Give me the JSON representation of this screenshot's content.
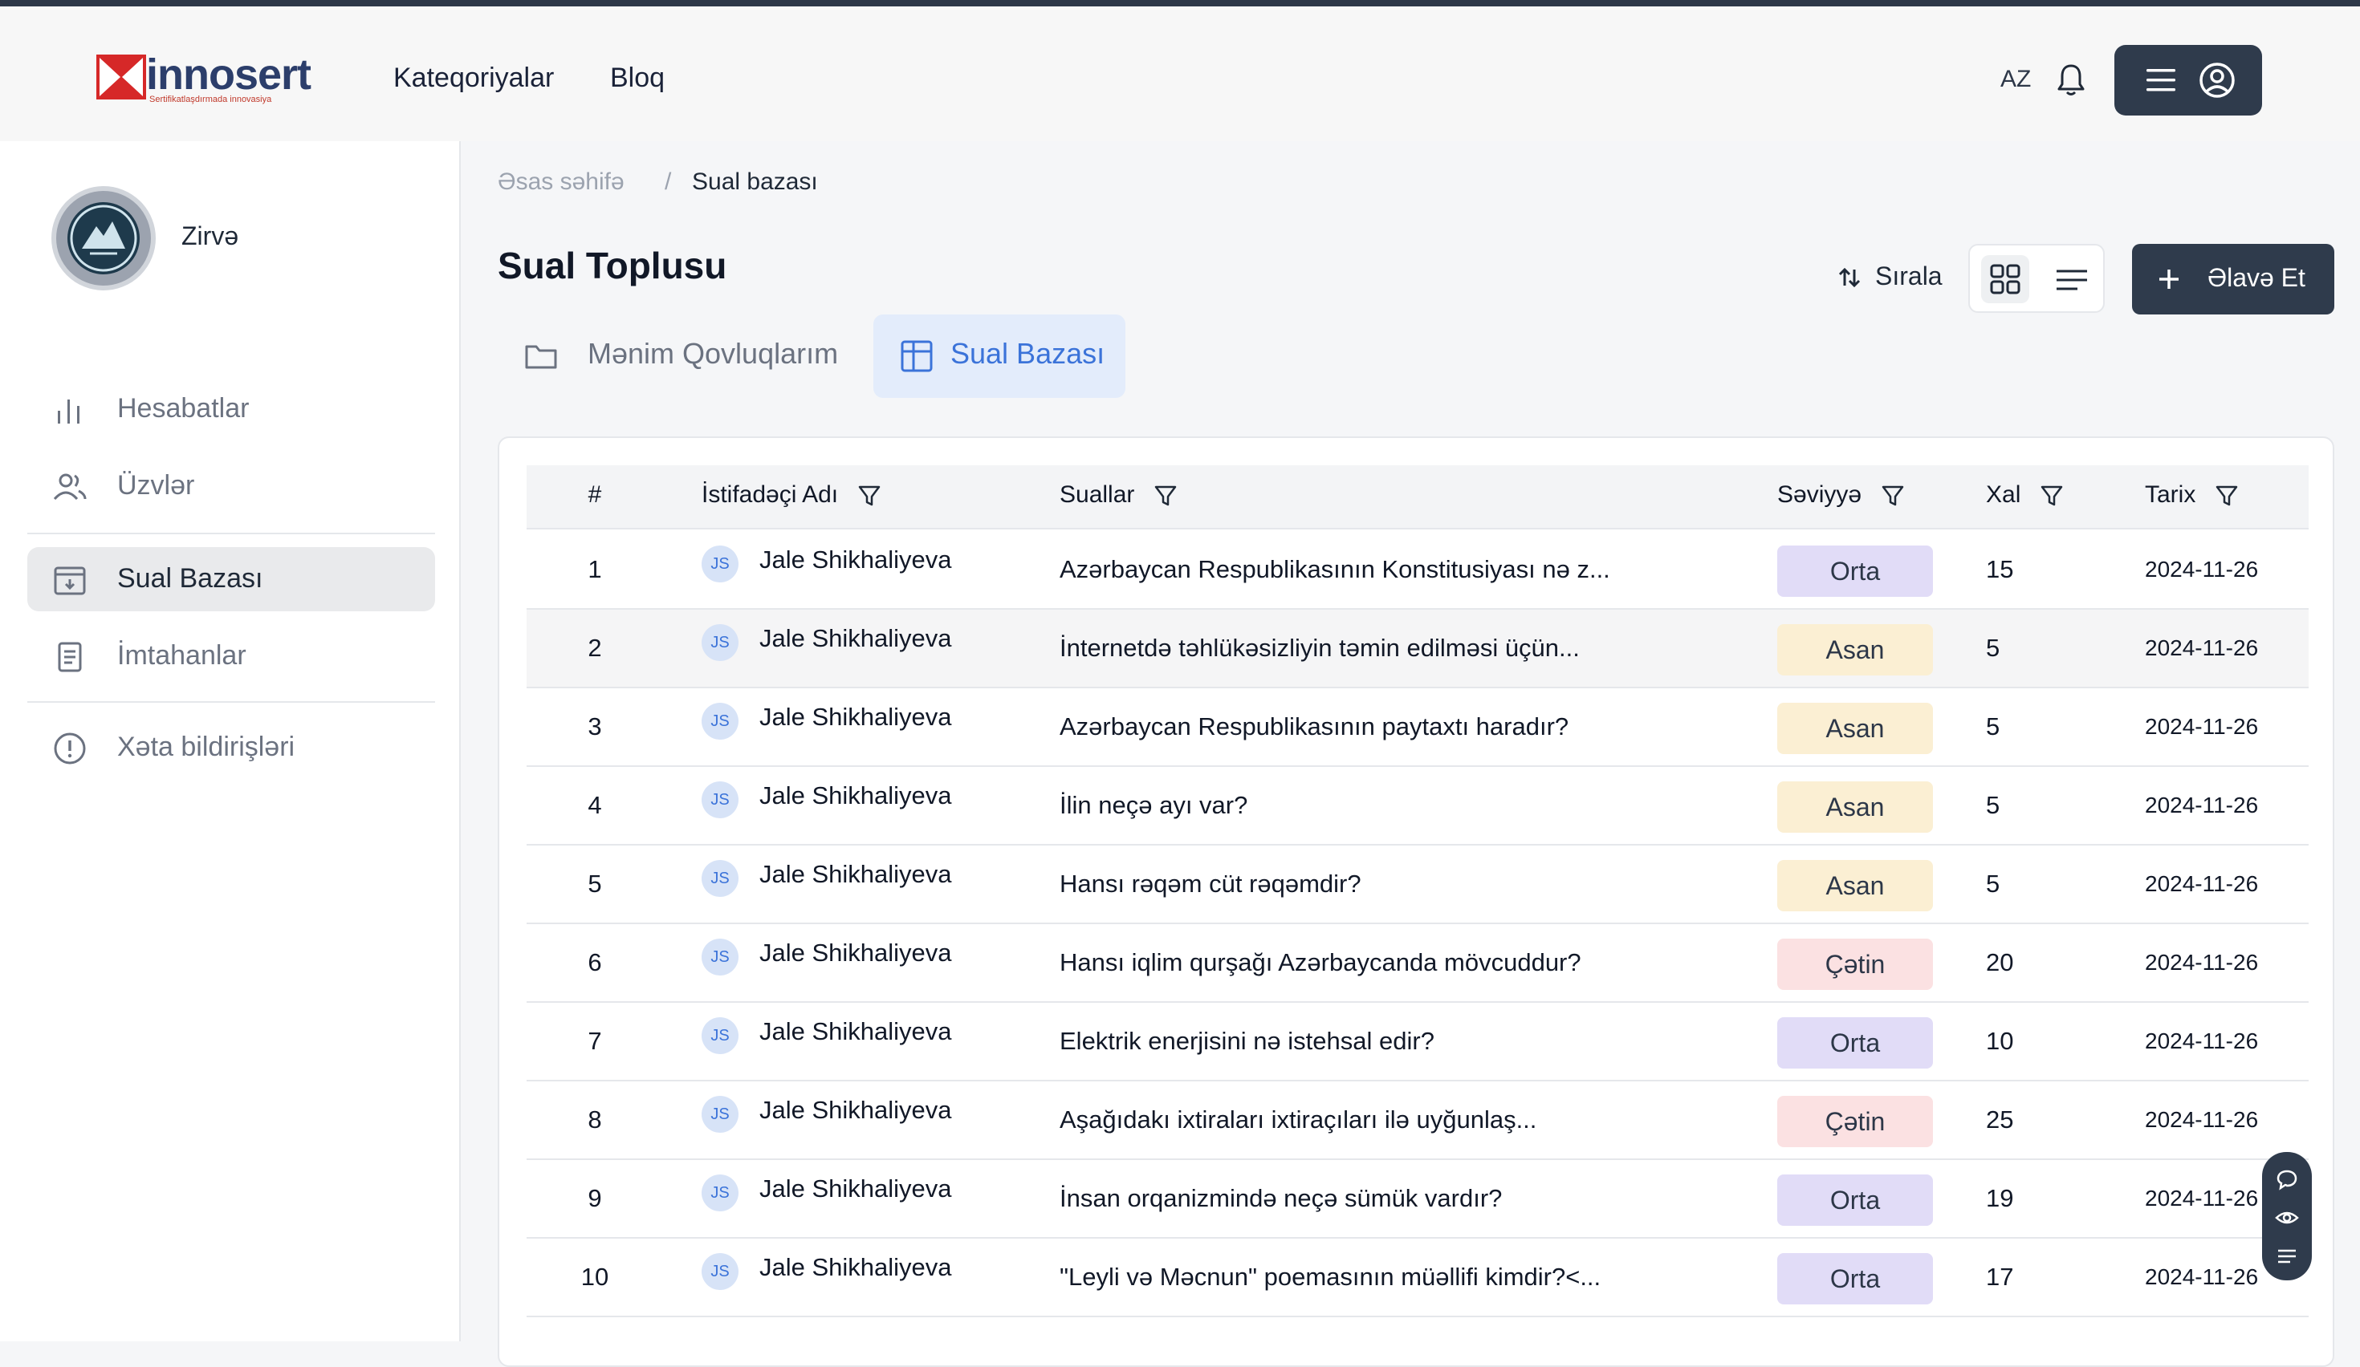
{
  "brand": {
    "name": "innosert",
    "tagline": "Sertifikatlaşdırmada innovasiya"
  },
  "nav": {
    "categories": "Kateqoriyalar",
    "blog": "Bloq"
  },
  "header": {
    "lang": "AZ"
  },
  "sidebar": {
    "user_name": "Zirvə",
    "items": [
      {
        "label": "Hesabatlar",
        "icon": "bar-chart-icon"
      },
      {
        "label": "Üzvlər",
        "icon": "users-icon"
      },
      {
        "label": "Sual Bazası",
        "icon": "archive-icon",
        "active": true
      },
      {
        "label": "İmtahanlar",
        "icon": "clipboard-icon"
      },
      {
        "label": "Xəta bildirişləri",
        "icon": "alert-circle-icon"
      }
    ]
  },
  "breadcrumb": {
    "home": "Əsas səhifə",
    "sep": "/",
    "current": "Sual bazası"
  },
  "page": {
    "title": "Sual Toplusu",
    "sort_label": "Sırala",
    "add_label": "Əlavə Et"
  },
  "tabs": [
    {
      "label": "Mənim Qovluqlarım",
      "icon": "folder-icon"
    },
    {
      "label": "Sual Bazası",
      "icon": "table-icon",
      "active": true
    }
  ],
  "table": {
    "headers": {
      "num": "#",
      "user": "İstifadəçi Adı",
      "questions": "Suallar",
      "level": "Səviyyə",
      "score": "Xal",
      "date": "Tarix"
    },
    "rows": [
      {
        "num": "1",
        "initials": "JS",
        "user": "Jale Shikhaliyeva",
        "question": "Azərbaycan Respublikasının Konstitusiyası nə z...",
        "level": "Orta",
        "score": "15",
        "date": "2024-11-26"
      },
      {
        "num": "2",
        "initials": "JS",
        "user": "Jale Shikhaliyeva",
        "question": "İnternetdə təhlükəsizliyin təmin edilməsi üçün...",
        "level": "Asan",
        "score": "5",
        "date": "2024-11-26"
      },
      {
        "num": "3",
        "initials": "JS",
        "user": "Jale Shikhaliyeva",
        "question": "Azərbaycan Respublikasının paytaxtı haradır?",
        "level": "Asan",
        "score": "5",
        "date": "2024-11-26"
      },
      {
        "num": "4",
        "initials": "JS",
        "user": "Jale Shikhaliyeva",
        "question": "İlin neçə ayı var?",
        "level": "Asan",
        "score": "5",
        "date": "2024-11-26"
      },
      {
        "num": "5",
        "initials": "JS",
        "user": "Jale Shikhaliyeva",
        "question": "Hansı rəqəm cüt rəqəmdir?",
        "level": "Asan",
        "score": "5",
        "date": "2024-11-26"
      },
      {
        "num": "6",
        "initials": "JS",
        "user": "Jale Shikhaliyeva",
        "question": "Hansı iqlim qurşağı Azərbaycanda mövcuddur?",
        "level": "Çətin",
        "score": "20",
        "date": "2024-11-26"
      },
      {
        "num": "7",
        "initials": "JS",
        "user": "Jale Shikhaliyeva",
        "question": "Elektrik enerjisini nə istehsal edir?",
        "level": "Orta",
        "score": "10",
        "date": "2024-11-26"
      },
      {
        "num": "8",
        "initials": "JS",
        "user": "Jale Shikhaliyeva",
        "question": "Aşağıdakı ixtiraları ixtiraçıları ilə uyğunlaş...",
        "level": "Çətin",
        "score": "25",
        "date": "2024-11-26"
      },
      {
        "num": "9",
        "initials": "JS",
        "user": "Jale Shikhaliyeva",
        "question": "İnsan orqanizmində neçə sümük vardır?",
        "level": "Orta",
        "score": "19",
        "date": "2024-11-26"
      },
      {
        "num": "10",
        "initials": "JS",
        "user": "Jale Shikhaliyeva",
        "question": "\"Leyli və Məcnun\" poemasının müəllifi kimdir?<...",
        "level": "Orta",
        "score": "17",
        "date": "2024-11-26"
      }
    ]
  },
  "colors": {
    "primary_dark": "#2f3b4c",
    "accent_blue": "#3b73d9",
    "orta": "#e1dcf7",
    "asan": "#fbefd3",
    "cetin": "#fbe1e2"
  }
}
